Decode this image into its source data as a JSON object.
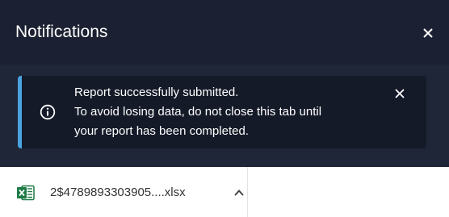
{
  "notifications": {
    "title": "Notifications",
    "toast": {
      "line1": "Report successfully submitted.",
      "line2": "To avoid losing data, do not close this tab until",
      "line3": "your report has been completed."
    }
  },
  "download": {
    "file_name": "2$4789893303905....xlsx"
  },
  "icons": {
    "close": "close-icon",
    "info": "info-icon",
    "file": "excel-file-icon",
    "chevron": "chevron-up-icon"
  },
  "colors": {
    "panel_bg": "#1f2637",
    "header_bg": "#1b2132",
    "toast_bg": "#141a28",
    "accent": "#4aa3e0",
    "excel_green": "#1d7a45"
  }
}
